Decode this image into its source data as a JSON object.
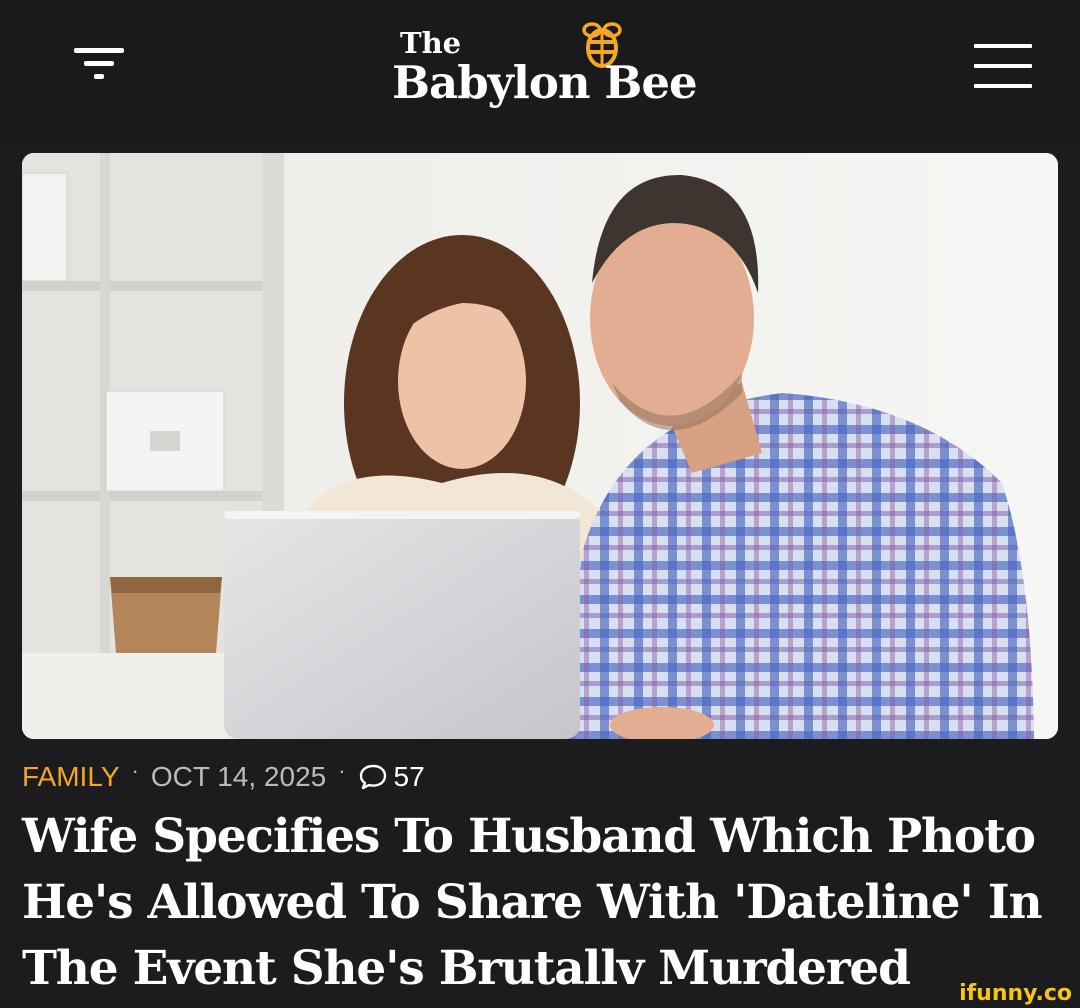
{
  "header": {
    "logo_the": "The",
    "logo_name": "Babylon Bee",
    "accent_color": "#f5a623",
    "filter_icon": "filter-icon",
    "menu_icon": "hamburger-menu-icon",
    "bee_icon": "bee-icon"
  },
  "article": {
    "image_description_icon": "hero-photo",
    "category": "FAMILY",
    "date": "OCT 14, 2025",
    "comment_count": "57",
    "comment_icon": "speech-bubble-icon",
    "headline": "Wife Specifies To Husband Which Photo He's Allowed To Share With 'Dateline' In The Event She's Brutallv Murdered"
  },
  "watermark": "ifunny.co"
}
